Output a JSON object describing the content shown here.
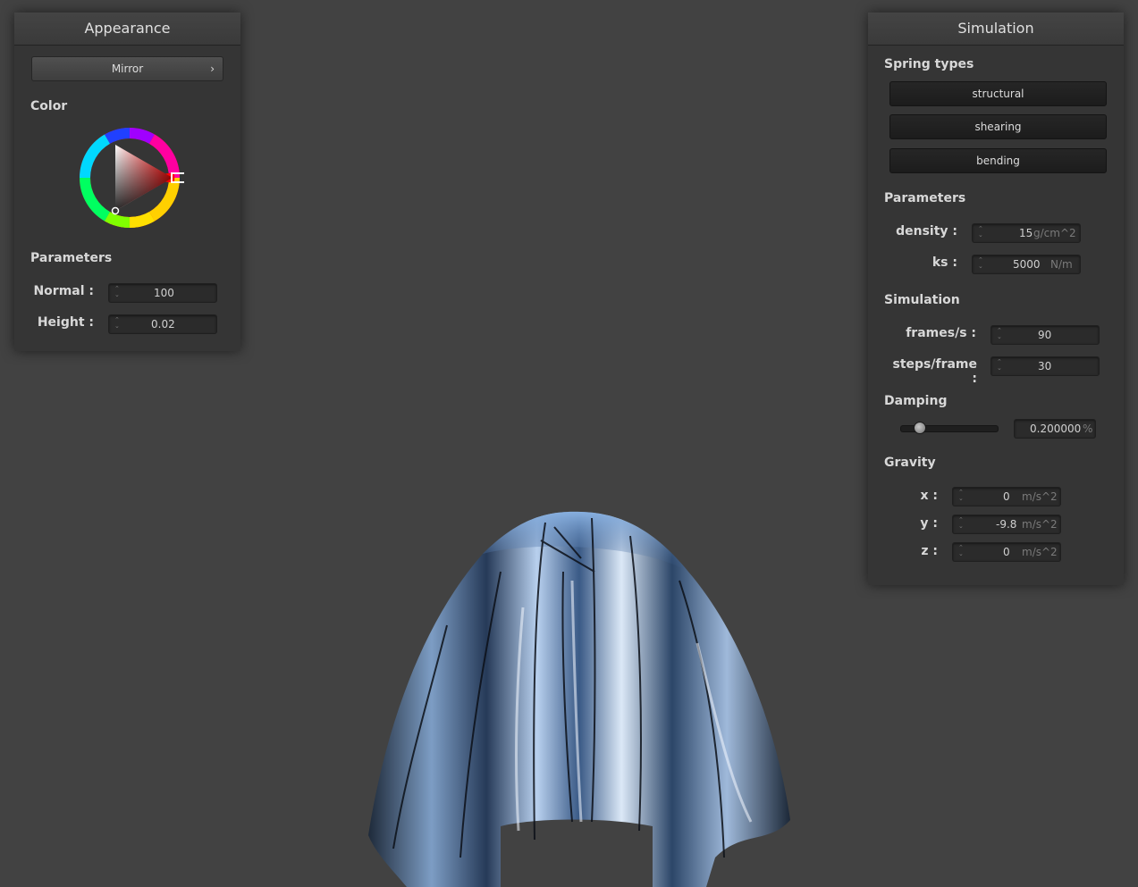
{
  "appearance": {
    "title": "Appearance",
    "shader_select": "Mirror",
    "color_label": "Color",
    "color_hue": "#ff0000",
    "params_label": "Parameters",
    "normal_label": "Normal :",
    "normal_value": "100",
    "height_label": "Height :",
    "height_value": "0.02"
  },
  "simulation": {
    "title": "Simulation",
    "spring_label": "Spring types",
    "spring_types": [
      "structural",
      "shearing",
      "bending"
    ],
    "params_label": "Parameters",
    "density_label": "density :",
    "density_value": "15",
    "density_unit": "g/cm^2",
    "ks_label": "ks :",
    "ks_value": "5000",
    "ks_unit": "N/m",
    "sim_label": "Simulation",
    "fps_label": "frames/s :",
    "fps_value": "90",
    "steps_label": "steps/frame :",
    "steps_value": "30",
    "damping_label": "Damping",
    "damping_value": "0.200000",
    "damping_unit": "%",
    "damping_fraction": 0.2,
    "gravity_label": "Gravity",
    "gx_label": "x :",
    "gx_value": "0",
    "gy_label": "y :",
    "gy_value": "-9.8",
    "gz_label": "z :",
    "gz_value": "0",
    "gravity_unit": "m/s^2"
  }
}
